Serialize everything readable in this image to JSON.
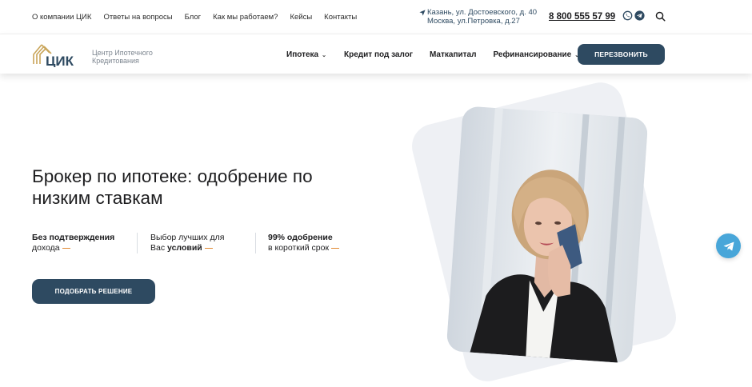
{
  "topnav": [
    "О компании ЦИК",
    "Ответы на вопросы",
    "Блог",
    "Как мы работаем?",
    "Кейсы",
    "Контакты"
  ],
  "address": {
    "line1": "Казань, ул. Достоевского, д. 40",
    "line2": "Москва, ул.Петровка, д.27",
    "icon": "location-arrow-icon"
  },
  "phone": "8 800 555 57 99",
  "social": [
    "whatsapp-icon",
    "telegram-icon"
  ],
  "logo": {
    "mark": "ЦИК",
    "tagline_1": "Центр Ипотечного",
    "tagline_2": "Кредитования",
    "brand_color": "#c9a55a",
    "dark_color": "#2e4a61"
  },
  "mainnav": [
    {
      "label": "Ипотека",
      "dropdown": true
    },
    {
      "label": "Кредит под залог",
      "dropdown": false
    },
    {
      "label": "Маткапитал",
      "dropdown": false
    },
    {
      "label": "Рефинансирование",
      "dropdown": true
    }
  ],
  "callback_label": "ПЕРЕЗВОНИТЬ",
  "hero": {
    "title": "Брокер по ипотеке: одобрение по низким ставкам",
    "features": [
      {
        "bold_1": "Без подтверждения",
        "text_2": "дохода"
      },
      {
        "text_1": "Выбор лучших для",
        "text_2a": "Вас ",
        "bold_2": "условий"
      },
      {
        "bold_1": "99% одобрение",
        "text_2": "в короткий срок"
      }
    ],
    "cta_label": "ПОДОБРАТЬ РЕШЕНИЕ"
  },
  "colors": {
    "accent": "#2e4a61",
    "dash": "#e28a32",
    "telegram": "#48a6d9"
  }
}
